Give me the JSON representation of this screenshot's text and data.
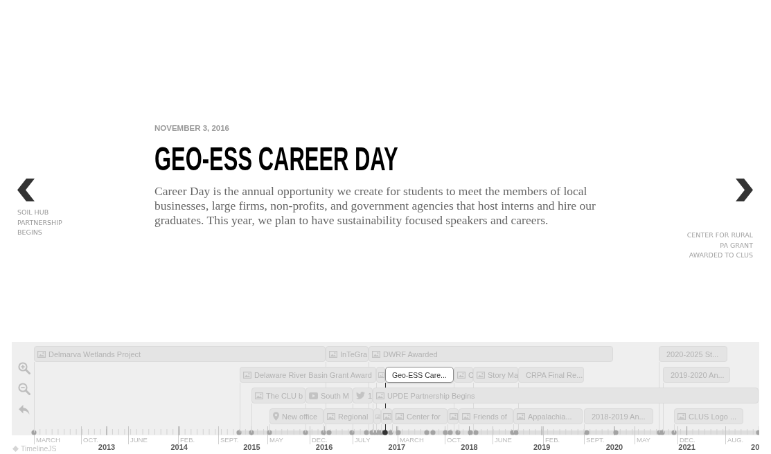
{
  "slide": {
    "date": "NOVEMBER 3, 2016",
    "headline": "GEO-ESS CAREER DAY",
    "text": "Career Day is the annual opportunity we create for students to meet the members of local businesses, large firms, non-profits, and government agencies that host interns and hire our graduates. This year, we plan to have sustainability focused speakers and careers."
  },
  "nav": {
    "previous": {
      "label": "SOIL HUB PARTNERSHIP BEGINS"
    },
    "next": {
      "label": "CENTER FOR RURAL PA GRANT AWARDED TO CLUS"
    }
  },
  "timeline": {
    "markers": [
      {
        "label": "Delmarva Wetlands Project",
        "kind": "image",
        "selected": false
      },
      {
        "label": "InTeGra",
        "kind": "image",
        "selected": false
      },
      {
        "label": "DWRF Awarded",
        "kind": "image",
        "selected": false
      },
      {
        "label": "2020-2025 St...",
        "kind": "plain",
        "selected": false
      },
      {
        "label": "Delaware River Basin Grant Award",
        "kind": "image",
        "selected": false
      },
      {
        "kind": "image",
        "selected": false
      },
      {
        "label": "Geo-ESS Care...",
        "kind": "plain",
        "selected": true
      },
      {
        "label": "C",
        "kind": "image",
        "selected": false
      },
      {
        "label": "Story Ma",
        "kind": "image",
        "selected": false
      },
      {
        "label": "CRPA Final Re...",
        "kind": "plain",
        "selected": false
      },
      {
        "label": "2019-2020 An...",
        "kind": "plain",
        "selected": false
      },
      {
        "label": "The CLU b",
        "kind": "image",
        "selected": false
      },
      {
        "label": "South M",
        "kind": "video",
        "selected": false
      },
      {
        "label": "1",
        "kind": "tweet",
        "selected": false
      },
      {
        "label": "UPDE Partnership Begins",
        "kind": "image",
        "selected": false
      },
      {
        "label": "New office",
        "kind": "location",
        "selected": false
      },
      {
        "label": "Regional",
        "kind": "image",
        "selected": false
      },
      {
        "kind": "image",
        "selected": false
      },
      {
        "kind": "image",
        "selected": false
      },
      {
        "label": "Center for",
        "kind": "image",
        "selected": false
      },
      {
        "kind": "image",
        "selected": false
      },
      {
        "label": "Friends of",
        "kind": "image",
        "selected": false
      },
      {
        "label": "Appalachia...",
        "kind": "image",
        "selected": false
      },
      {
        "label": "2018-2019 An...",
        "kind": "plain",
        "selected": false
      },
      {
        "label": "CLUS Logo ...",
        "kind": "image",
        "selected": false
      }
    ],
    "axis": {
      "month_labels": [
        "MARCH",
        "OCT.",
        "JUNE",
        "FEB.",
        "SEPT.",
        "MAY",
        "DEC.",
        "JULY",
        "MARCH",
        "OCT.",
        "JUNE",
        "FEB.",
        "SEPT.",
        "MAY",
        "DEC.",
        "AUG."
      ],
      "year_labels": [
        "2013",
        "2014",
        "2015",
        "2016",
        "2017",
        "2018",
        "2019",
        "2020",
        "2021",
        "20"
      ]
    }
  },
  "logo": {
    "text": "TimelineJS"
  }
}
